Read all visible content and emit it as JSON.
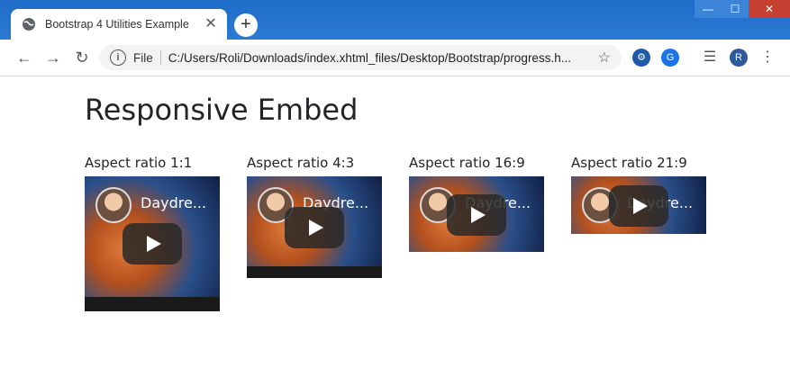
{
  "browser": {
    "tab_title": "Bootstrap 4 Utilities Example",
    "tab_close": "✕",
    "new_tab": "+",
    "omnibox_file_label": "File",
    "url": "C:/Users/Roli/Downloads/index.xhtml_files/Desktop/Bootstrap/progress.h...",
    "profile_initial": "R"
  },
  "page": {
    "heading": "Responsive Embed",
    "embeds": [
      {
        "label": "Aspect ratio 1:1",
        "video_title": "Daydre..."
      },
      {
        "label": "Aspect ratio 4:3",
        "video_title": "Daydre..."
      },
      {
        "label": "Aspect ratio 16:9",
        "video_title": "Daydre..."
      },
      {
        "label": "Aspect ratio 21:9",
        "video_title": "Daydre..."
      }
    ]
  },
  "colors": {
    "titlebar": "#2b7ad4",
    "profile_avatar": "#2d5a9e",
    "heading_text": "#212529"
  }
}
